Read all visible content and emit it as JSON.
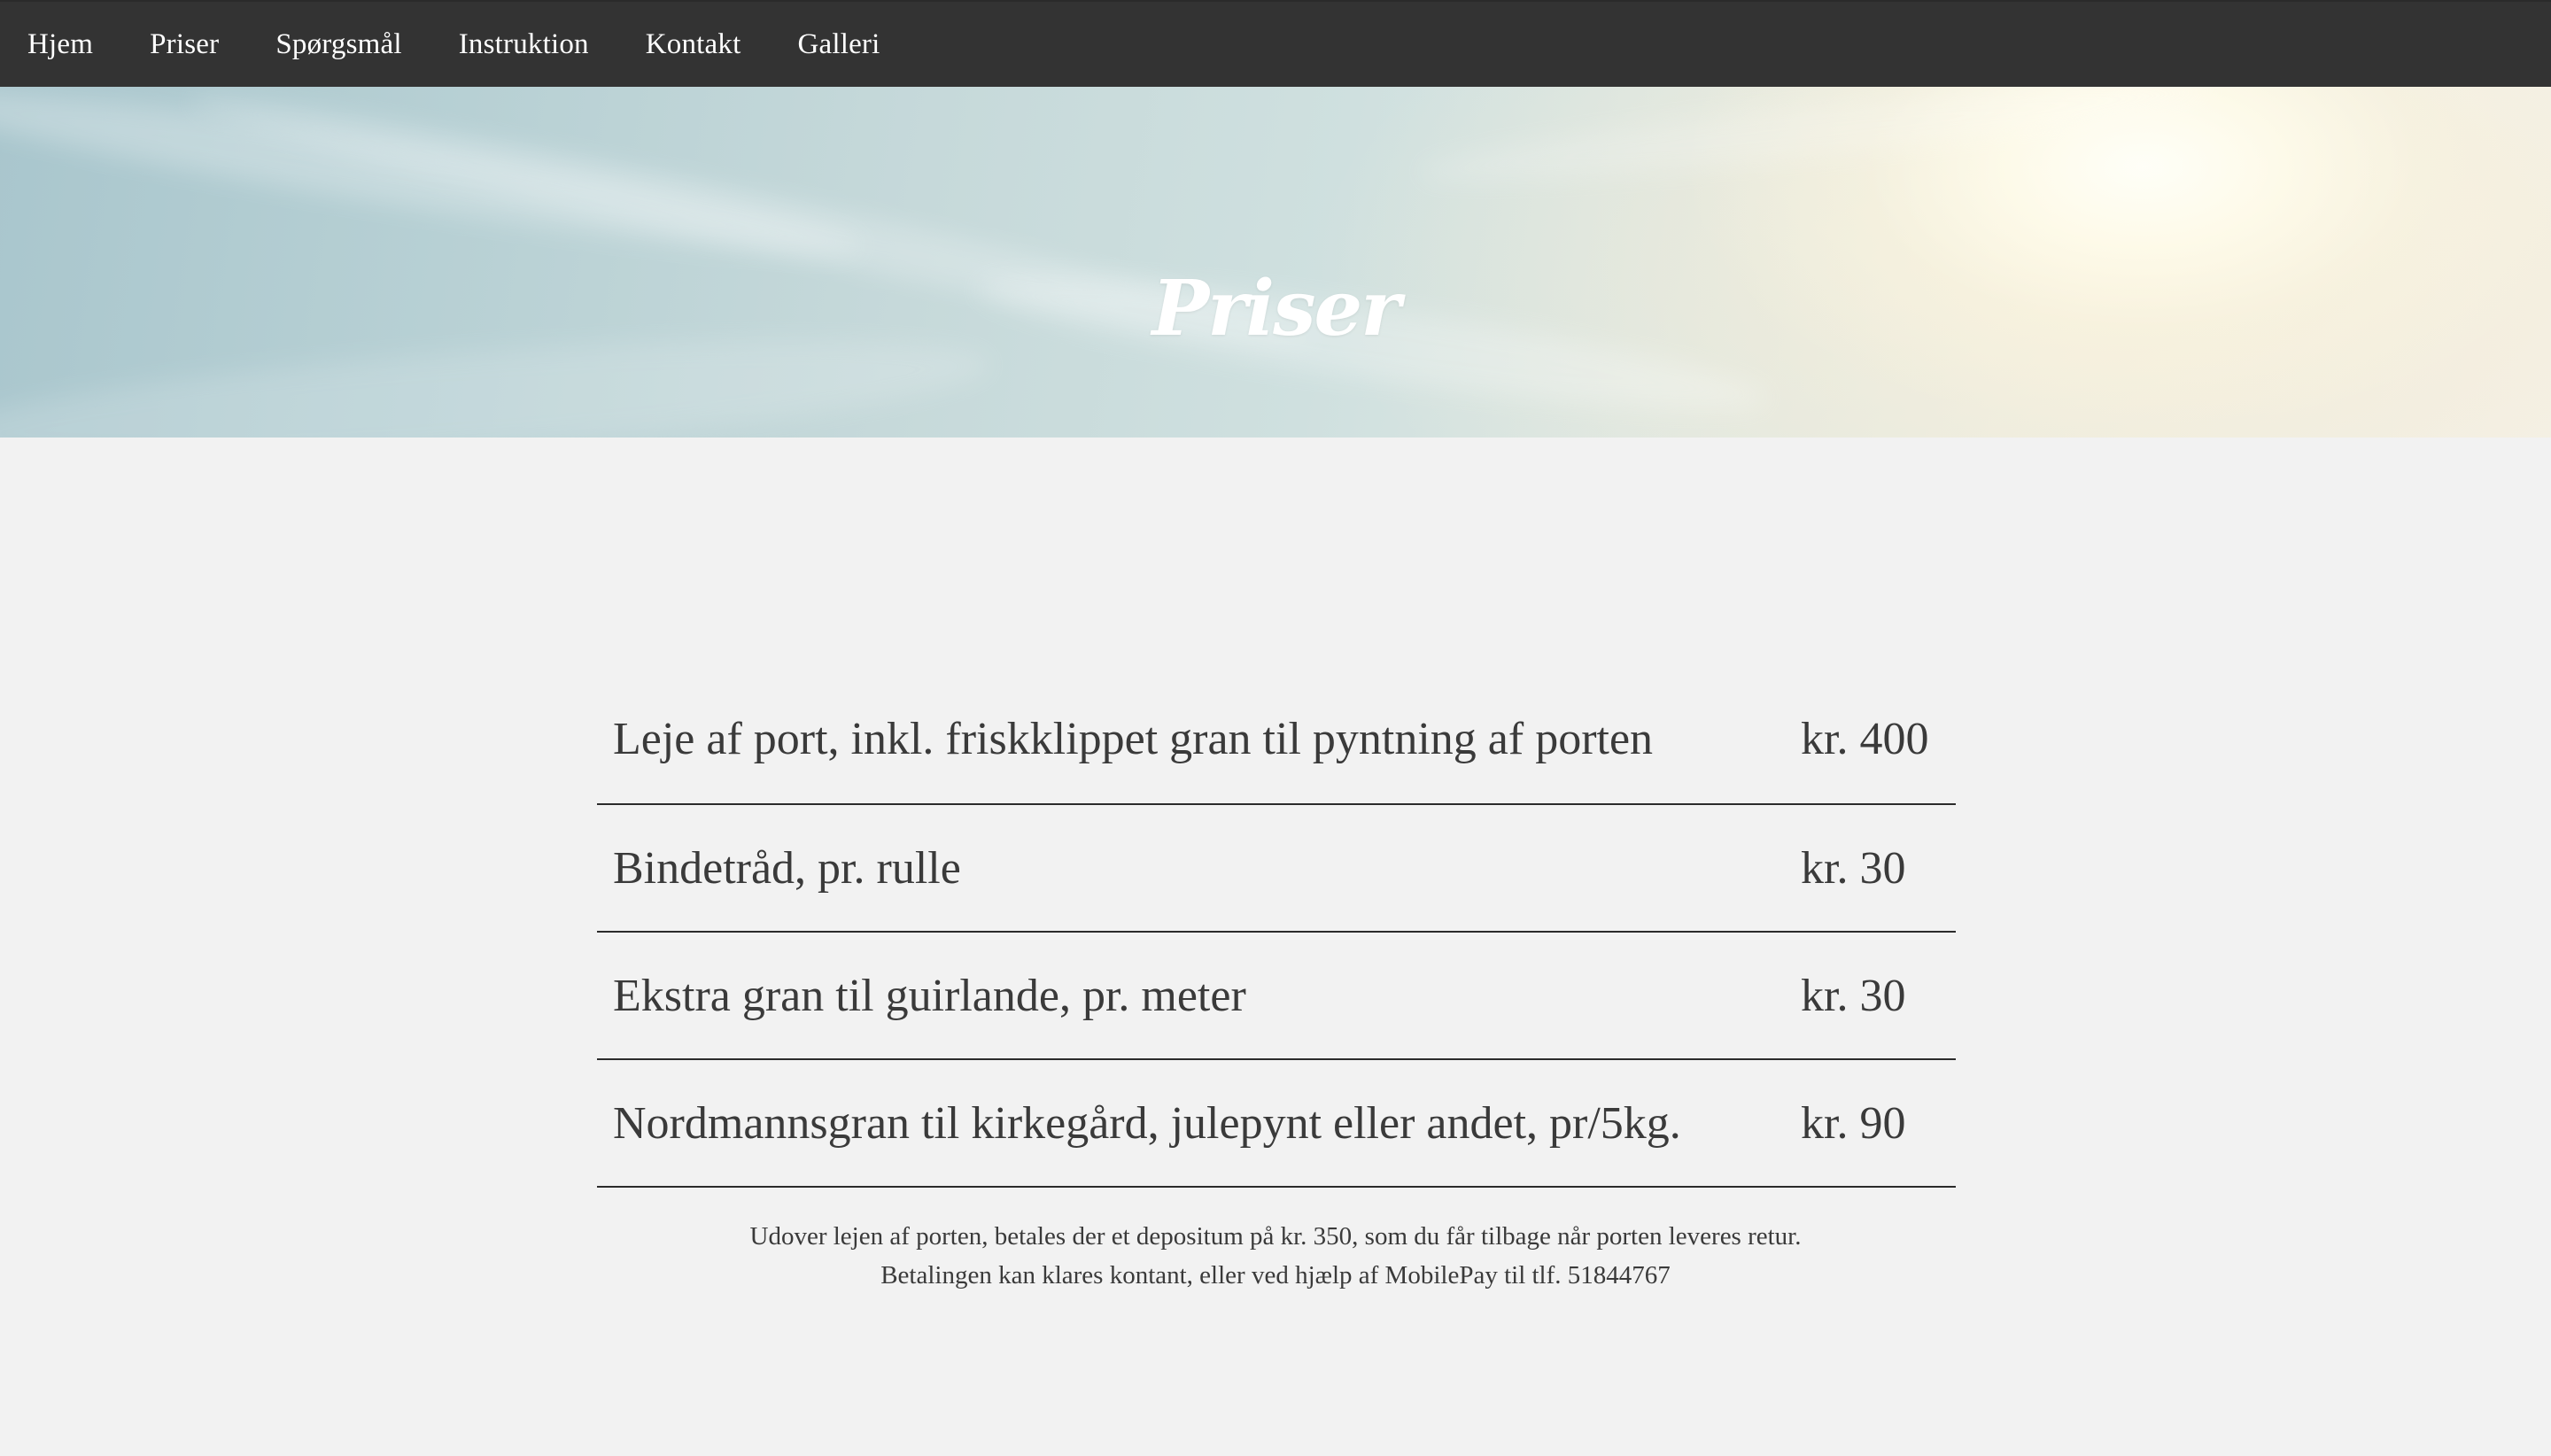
{
  "nav": {
    "items": [
      {
        "label": "Hjem"
      },
      {
        "label": "Priser"
      },
      {
        "label": "Spørgsmål"
      },
      {
        "label": "Instruktion"
      },
      {
        "label": "Kontakt"
      },
      {
        "label": "Galleri"
      }
    ],
    "background_color": "#333333",
    "text_color": "#ffffff"
  },
  "hero": {
    "title": "Priser",
    "image": "sky with clouds and sun"
  },
  "prices": {
    "rows": [
      {
        "label": "Leje af port, inkl. friskklippet gran til pyntning af porten",
        "price": "kr. 400"
      },
      {
        "label": "Bindetråd, pr. rulle",
        "price": "kr. 30"
      },
      {
        "label": "Ekstra gran til guirlande, pr. meter",
        "price": "kr. 30"
      },
      {
        "label": "Nordmannsgran til kirkegård, julepynt eller andet, pr/5kg.",
        "price": "kr. 90"
      }
    ]
  },
  "note": {
    "line1": "Udover lejen af porten, betales der et depositum på kr. 350, som du får tilbage når porten leveres retur.",
    "line2": "Betalingen kan klares kontant, eller ved hjælp af MobilePay til tlf. 51844767"
  },
  "colors": {
    "page_background": "#f2f2f2",
    "text": "#3a3a3a",
    "divider": "#2b2b2b"
  }
}
